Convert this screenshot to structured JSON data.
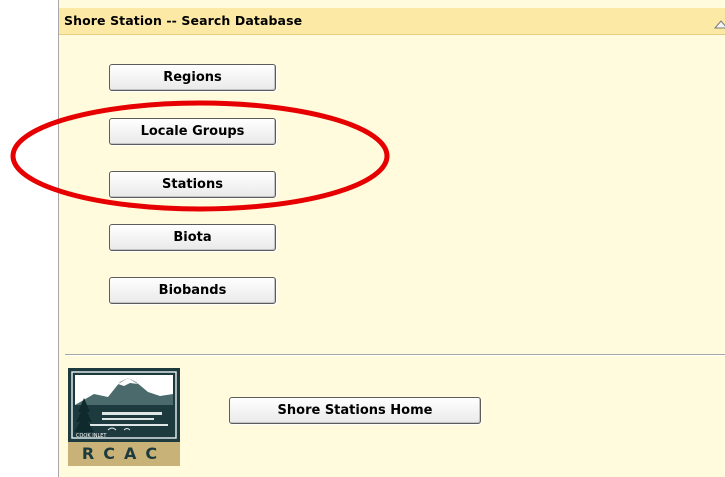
{
  "panel": {
    "title": "Shore Station -- Search Database",
    "collapse_icon": "collapse-up-arrow-icon"
  },
  "buttons": {
    "regions": "Regions",
    "locale_groups": "Locale Groups",
    "stations": "Stations",
    "biota": "Biota",
    "biobands": "Biobands",
    "home": "Shore Stations Home"
  },
  "logo": {
    "top_text": "COOK INLET",
    "main_text": "RCAC",
    "colors": {
      "dark": "#1d3b3e",
      "gold": "#c9b277",
      "sky": "#ffffff"
    }
  },
  "annotation": {
    "shape": "ellipse",
    "color": "#e60000"
  }
}
